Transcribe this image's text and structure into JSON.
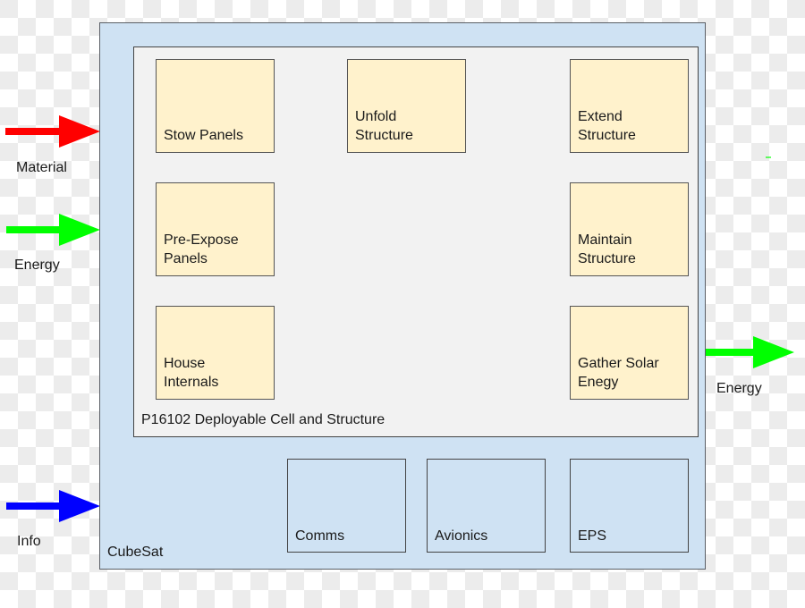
{
  "diagram": {
    "outer_frame": {
      "label": "CubeSat"
    },
    "inner_frame": {
      "label": "P16102 Deployable Cell and Structure"
    },
    "functions": {
      "stow_panels": {
        "label": "Stow Panels"
      },
      "unfold_structure": {
        "label": "Unfold\nStructure"
      },
      "extend_structure": {
        "label": "Extend\nStructure"
      },
      "pre_expose_panels": {
        "label": "Pre-Expose\nPanels"
      },
      "maintain_structure": {
        "label": "Maintain\nStructure"
      },
      "house_internals": {
        "label": "House\nInternals"
      },
      "gather_solar_energy": {
        "label": "Gather Solar\nEnegy"
      }
    },
    "subsystems": {
      "comms": {
        "label": "Comms"
      },
      "avionics": {
        "label": "Avionics"
      },
      "eps": {
        "label": "EPS"
      }
    },
    "inputs": [
      {
        "label": "Material",
        "type": "material"
      },
      {
        "label": "Energy",
        "type": "energy"
      },
      {
        "label": "Info",
        "type": "info"
      }
    ],
    "outputs": [
      {
        "label": "Energy",
        "type": "energy"
      }
    ],
    "colors": {
      "material": "#ff0000",
      "energy": "#00ff00",
      "info": "#0000ff",
      "outer_fill": "#cfe2f3",
      "inner_fill": "#f2f2f2",
      "function_fill": "#fff2cc"
    }
  }
}
